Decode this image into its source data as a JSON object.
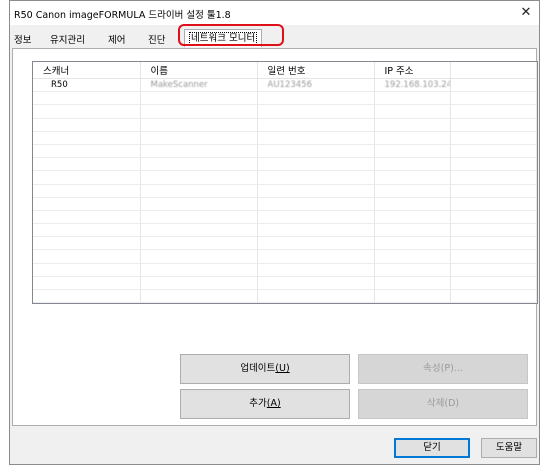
{
  "window": {
    "title": "R50 Canon imageFORMULA 드라이버 설정 툴1.8",
    "close_symbol": "✕"
  },
  "tabs": [
    {
      "label": "정보"
    },
    {
      "label": "유지관리"
    },
    {
      "label": "제어"
    },
    {
      "label": "진단"
    },
    {
      "label": "네트워크 모니터"
    }
  ],
  "scanner_list": {
    "columns": [
      "스캐너",
      "이름",
      "일련 번호",
      "IP 주소"
    ],
    "rows": [
      {
        "scanner": "R50",
        "name": "MakeScanner",
        "serial": "AU123456",
        "ip": "192.168.103.24"
      }
    ]
  },
  "buttons": {
    "update": {
      "label": "업데이트",
      "mnemonic": "(U)"
    },
    "properties": {
      "label": "속성",
      "mnemonic": "(P)..."
    },
    "add": {
      "label": "추가",
      "mnemonic": "(A)"
    },
    "delete": {
      "label": "삭제",
      "mnemonic": "(D)"
    },
    "close": {
      "label": "닫기"
    },
    "help": {
      "label": "도움말"
    }
  },
  "colors": {
    "highlight": "#e0101a",
    "focus_border": "#0078d7"
  }
}
